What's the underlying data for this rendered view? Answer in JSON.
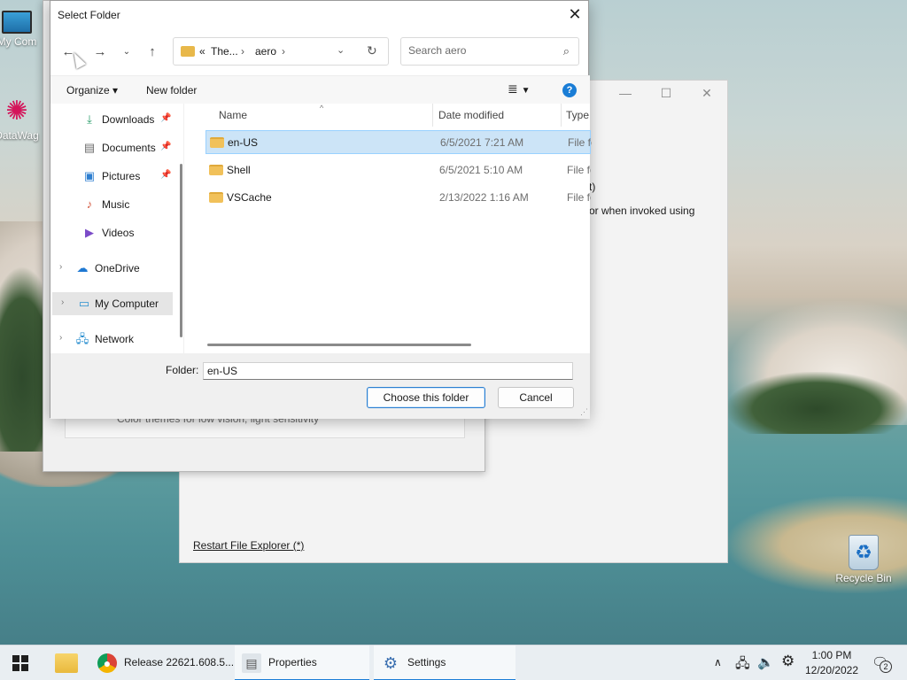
{
  "desktop": {
    "icons": [
      {
        "label": "My Com",
        "icon": "computer-icon"
      },
      {
        "label": "DataWag",
        "icon": "datawagon-icon"
      },
      {
        "label": "Recycle Bin",
        "icon": "recycle-bin-icon"
      }
    ]
  },
  "background_window": {
    "text_line1": "t)",
    "text_line2": "or when invoked using",
    "link": "Restart File Explorer (*)"
  },
  "properties_window": {
    "card_text": "Color themes for low vision, light sensitivity"
  },
  "dialog": {
    "title": "Select Folder",
    "address": {
      "overflow": "«",
      "segments": [
        "The...",
        "aero"
      ]
    },
    "search_placeholder": "Search aero",
    "commands": {
      "organize": "Organize",
      "new_folder": "New folder"
    },
    "nav_items": [
      {
        "label": "Downloads",
        "icon": "download-icon",
        "pinned": true
      },
      {
        "label": "Documents",
        "icon": "documents-icon",
        "pinned": true
      },
      {
        "label": "Pictures",
        "icon": "pictures-icon",
        "pinned": true
      },
      {
        "label": "Music",
        "icon": "music-icon",
        "pinned": false
      },
      {
        "label": "Videos",
        "icon": "videos-icon",
        "pinned": false
      },
      {
        "label": "OneDrive",
        "icon": "onedrive-icon",
        "expandable": true
      },
      {
        "label": "My Computer",
        "icon": "computer-icon",
        "expandable": true,
        "selected": true
      },
      {
        "label": "Network",
        "icon": "network-icon",
        "expandable": true
      }
    ],
    "columns": [
      "Name",
      "Date modified",
      "Type"
    ],
    "files": [
      {
        "name": "en-US",
        "date": "6/5/2021 7:21 AM",
        "type": "File fo",
        "selected": true
      },
      {
        "name": "Shell",
        "date": "6/5/2021 5:10 AM",
        "type": "File fo"
      },
      {
        "name": "VSCache",
        "date": "2/13/2022 1:16 AM",
        "type": "File fo"
      }
    ],
    "folder_label": "Folder:",
    "folder_value": "en-US",
    "choose_button": "Choose this folder",
    "cancel_button": "Cancel"
  },
  "taskbar": {
    "items": [
      {
        "label": "Release 22621.608.5...",
        "icon": "chrome-icon"
      },
      {
        "label": "Properties",
        "icon": "properties-icon"
      },
      {
        "label": "Settings",
        "icon": "settings-icon"
      }
    ],
    "time": "1:00 PM",
    "date": "12/20/2022",
    "notification_count": "2"
  },
  "colors": {
    "accent": "#1a7dd6",
    "selection": "#cce4f7",
    "folder": "#f1c15a"
  }
}
